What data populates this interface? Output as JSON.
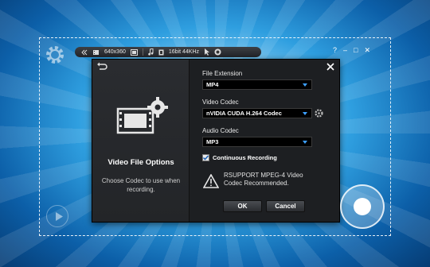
{
  "toolbar": {
    "resolution": "640x360",
    "audio_format": "16bit 44KHz",
    "icons": [
      "collapse-icon",
      "video-icon",
      "resize-icon",
      "music-note-icon",
      "audio-chip-icon",
      "cursor-icon",
      "webcam-icon"
    ]
  },
  "window_controls": {
    "help": "?",
    "minimize": "–",
    "maximize": "□",
    "close": "✕"
  },
  "dialog": {
    "left": {
      "title": "Video File Options",
      "description": "Choose Codec to use when recording."
    },
    "file_extension": {
      "label": "File Extension",
      "value": "MP4"
    },
    "video_codec": {
      "label": "Video Codec",
      "value": "nVIDIA CUDA H.264 Codec"
    },
    "audio_codec": {
      "label": "Audio Codec",
      "value": "MP3"
    },
    "continuous_recording": {
      "label": "Continuous Recording",
      "checked": true
    },
    "notice": "RSUPPORT MPEG-4 Video Codec Recommended.",
    "ok_label": "OK",
    "cancel_label": "Cancel"
  },
  "colors": {
    "accent": "#3da0ff",
    "dialog_bg": "#1d1f22"
  }
}
